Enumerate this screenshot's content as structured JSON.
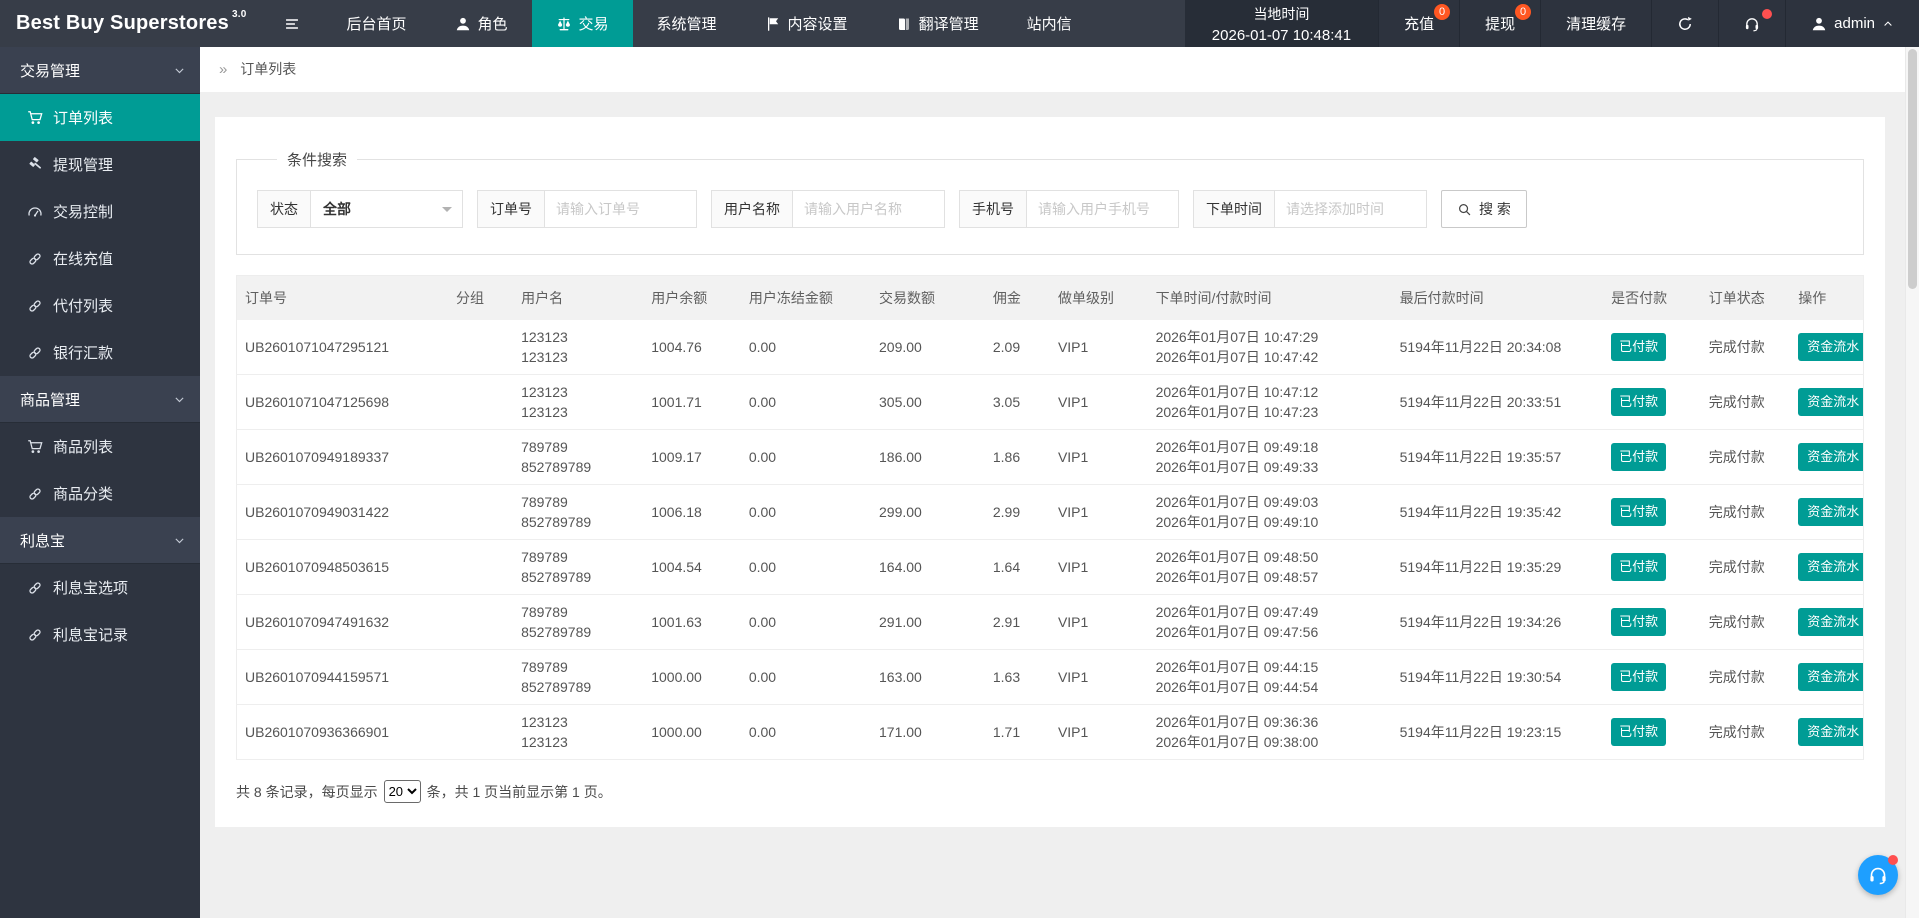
{
  "colors": {
    "accent_teal": "#009c95",
    "header_bg": "#373d48",
    "sidebar_bg": "#2e3440",
    "badge_orange": "#ff5722",
    "float_button_blue": "#1e9fff"
  },
  "navbar": {
    "brand": "Best Buy Superstores",
    "brand_version": "3.0",
    "menu": [
      {
        "key": "home",
        "label": "后台首页",
        "icon": null,
        "active": false
      },
      {
        "key": "roles",
        "label": "角色",
        "icon": "person",
        "active": false
      },
      {
        "key": "trade",
        "label": "交易",
        "icon": "scales",
        "active": true
      },
      {
        "key": "system-manage",
        "label": "系统管理",
        "icon": null,
        "active": false
      },
      {
        "key": "content-settings",
        "label": "内容设置",
        "icon": "flag",
        "active": false
      },
      {
        "key": "translate-manage",
        "label": "翻译管理",
        "icon": "book",
        "active": false
      },
      {
        "key": "site-mail",
        "label": "站内信",
        "icon": null,
        "active": false
      }
    ],
    "local_time_label": "当地时间",
    "local_time_value": "2026-01-07 10:48:41",
    "quick_links": [
      {
        "key": "recharge",
        "label": "充值",
        "badge": "0"
      },
      {
        "key": "withdraw",
        "label": "提现",
        "badge": "0"
      },
      {
        "key": "clear-cache",
        "label": "清理缓存",
        "badge": null
      }
    ],
    "username": "admin"
  },
  "sidebar": {
    "groups": [
      {
        "key": "trade-manage",
        "label": "交易管理",
        "items": [
          {
            "key": "order-list",
            "label": "订单列表",
            "icon": "cart",
            "active": true
          },
          {
            "key": "withdraw-manage",
            "label": "提现管理",
            "icon": "gavel",
            "active": false
          },
          {
            "key": "trade-control",
            "label": "交易控制",
            "icon": "gauge",
            "active": false
          },
          {
            "key": "online-recharge",
            "label": "在线充值",
            "icon": "link",
            "active": false
          },
          {
            "key": "proxy-pay-list",
            "label": "代付列表",
            "icon": "link",
            "active": false
          },
          {
            "key": "bank-remittance",
            "label": "银行汇款",
            "icon": "link",
            "active": false
          }
        ]
      },
      {
        "key": "goods-manage",
        "label": "商品管理",
        "items": [
          {
            "key": "goods-list",
            "label": "商品列表",
            "icon": "cart",
            "active": false
          },
          {
            "key": "goods-category",
            "label": "商品分类",
            "icon": "link",
            "active": false
          }
        ]
      },
      {
        "key": "interest-treasure",
        "label": "利息宝",
        "items": [
          {
            "key": "interest-options",
            "label": "利息宝选项",
            "icon": "link",
            "active": false
          },
          {
            "key": "interest-records",
            "label": "利息宝记录",
            "icon": "link",
            "active": false
          }
        ]
      }
    ]
  },
  "breadcrumb": {
    "symbol": "»",
    "current": "订单列表"
  },
  "search": {
    "legend": "条件搜索",
    "status_label": "状态",
    "status_value": "全部",
    "fields": [
      {
        "key": "order-no",
        "label": "订单号",
        "placeholder": "请输入订单号"
      },
      {
        "key": "user-name",
        "label": "用户名称",
        "placeholder": "请输入用户名称"
      },
      {
        "key": "phone",
        "label": "手机号",
        "placeholder": "请输入用户手机号"
      },
      {
        "key": "order-time",
        "label": "下单时间",
        "placeholder": "请选择添加时间"
      }
    ],
    "search_button": "搜 索"
  },
  "table": {
    "headers": [
      "订单号",
      "分组",
      "用户名",
      "用户余额",
      "用户冻结金额",
      "交易数额",
      "佣金",
      "做单级别",
      "下单时间/付款时间",
      "最后付款时间",
      "是否付款",
      "订单状态",
      "操作"
    ],
    "paid_badge": "已付款",
    "status_text": "完成付款",
    "action_button": "资金流水",
    "rows": [
      {
        "order_no": "UB2601071047295121",
        "group": "",
        "user": [
          "123123",
          "123123"
        ],
        "balance": "1004.76",
        "frozen": "0.00",
        "amount": "209.00",
        "commission": "2.09",
        "level": "VIP1",
        "times": [
          "2026年01月07日 10:47:29",
          "2026年01月07日 10:47:42"
        ],
        "last_pay": "5194年11月22日 20:34:08"
      },
      {
        "order_no": "UB2601071047125698",
        "group": "",
        "user": [
          "123123",
          "123123"
        ],
        "balance": "1001.71",
        "frozen": "0.00",
        "amount": "305.00",
        "commission": "3.05",
        "level": "VIP1",
        "times": [
          "2026年01月07日 10:47:12",
          "2026年01月07日 10:47:23"
        ],
        "last_pay": "5194年11月22日 20:33:51"
      },
      {
        "order_no": "UB2601070949189337",
        "group": "",
        "user": [
          "789789",
          "852789789"
        ],
        "balance": "1009.17",
        "frozen": "0.00",
        "amount": "186.00",
        "commission": "1.86",
        "level": "VIP1",
        "times": [
          "2026年01月07日 09:49:18",
          "2026年01月07日 09:49:33"
        ],
        "last_pay": "5194年11月22日 19:35:57"
      },
      {
        "order_no": "UB2601070949031422",
        "group": "",
        "user": [
          "789789",
          "852789789"
        ],
        "balance": "1006.18",
        "frozen": "0.00",
        "amount": "299.00",
        "commission": "2.99",
        "level": "VIP1",
        "times": [
          "2026年01月07日 09:49:03",
          "2026年01月07日 09:49:10"
        ],
        "last_pay": "5194年11月22日 19:35:42"
      },
      {
        "order_no": "UB2601070948503615",
        "group": "",
        "user": [
          "789789",
          "852789789"
        ],
        "balance": "1004.54",
        "frozen": "0.00",
        "amount": "164.00",
        "commission": "1.64",
        "level": "VIP1",
        "times": [
          "2026年01月07日 09:48:50",
          "2026年01月07日 09:48:57"
        ],
        "last_pay": "5194年11月22日 19:35:29"
      },
      {
        "order_no": "UB2601070947491632",
        "group": "",
        "user": [
          "789789",
          "852789789"
        ],
        "balance": "1001.63",
        "frozen": "0.00",
        "amount": "291.00",
        "commission": "2.91",
        "level": "VIP1",
        "times": [
          "2026年01月07日 09:47:49",
          "2026年01月07日 09:47:56"
        ],
        "last_pay": "5194年11月22日 19:34:26"
      },
      {
        "order_no": "UB2601070944159571",
        "group": "",
        "user": [
          "789789",
          "852789789"
        ],
        "balance": "1000.00",
        "frozen": "0.00",
        "amount": "163.00",
        "commission": "1.63",
        "level": "VIP1",
        "times": [
          "2026年01月07日 09:44:15",
          "2026年01月07日 09:44:54"
        ],
        "last_pay": "5194年11月22日 19:30:54"
      },
      {
        "order_no": "UB2601070936366901",
        "group": "",
        "user": [
          "123123",
          "123123"
        ],
        "balance": "1000.00",
        "frozen": "0.00",
        "amount": "171.00",
        "commission": "1.71",
        "level": "VIP1",
        "times": [
          "2026年01月07日 09:36:36",
          "2026年01月07日 09:38:00"
        ],
        "last_pay": "5194年11月22日 19:23:15"
      }
    ]
  },
  "pagination": {
    "prefix": "共 8 条记录，每页显示",
    "page_size": "20",
    "suffix": "条，共 1 页当前显示第 1 页。"
  }
}
